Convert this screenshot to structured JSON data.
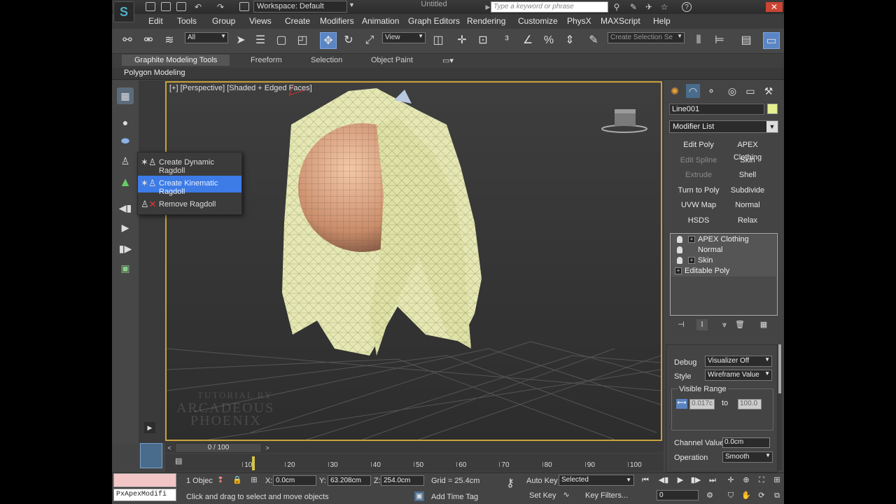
{
  "titlebar": {
    "workspace": "Workspace: Default",
    "doc_title": "Untitled",
    "search_placeholder": "Type a keyword or phrase"
  },
  "menu": [
    "Edit",
    "Tools",
    "Group",
    "Views",
    "Create",
    "Modifiers",
    "Animation",
    "Graph Editors",
    "Rendering",
    "Customize",
    "PhysX",
    "MAXScript",
    "Help"
  ],
  "toolbar": {
    "filter_value": "All",
    "refcoord_value": "View",
    "selection_set_placeholder": "Create Selection Se"
  },
  "ribbon": {
    "tabs": [
      "Graphite Modeling Tools",
      "Freeform",
      "Selection",
      "Object Paint"
    ],
    "sublabel": "Polygon Modeling"
  },
  "flyout": {
    "items": [
      "Create Dynamic Ragdoll",
      "Create Kinematic Ragdoll",
      "Remove Ragdoll"
    ]
  },
  "viewport": {
    "label": "[+] [Perspective] [Shaded + Edged Faces]",
    "watermark_line1": "TUTORIAL BY",
    "watermark_line2": "ARCADEOUS",
    "watermark_line3": "PHOENIX"
  },
  "command_panel": {
    "object_name": "Line001",
    "object_color": "#e6f08f",
    "modifier_list": "Modifier List",
    "modifier_buttons": [
      {
        "label": "Edit Poly",
        "dim": false
      },
      {
        "label": "APEX Clothing",
        "dim": false
      },
      {
        "label": "Edit Spline",
        "dim": true
      },
      {
        "label": "Skin",
        "dim": false
      },
      {
        "label": "Extrude",
        "dim": true
      },
      {
        "label": "Shell",
        "dim": false
      },
      {
        "label": "Turn to Poly",
        "dim": false
      },
      {
        "label": "Subdivide",
        "dim": false
      },
      {
        "label": "UVW Map",
        "dim": false
      },
      {
        "label": "Normal",
        "dim": false
      },
      {
        "label": "HSDS",
        "dim": false
      },
      {
        "label": "Relax",
        "dim": false
      }
    ],
    "stack": [
      "APEX Clothing",
      "Normal",
      "Skin",
      "Editable Poly"
    ],
    "debug_label": "Debug",
    "debug_value": "Visualizer Off",
    "style_label": "Style",
    "style_value": "Wireframe Value",
    "visible_range_label": "Visible Range",
    "range_from": "0.017c",
    "range_to_label": "to",
    "range_to": "100.0",
    "channel_value_label": "Channel Value",
    "channel_value": "0.0cm",
    "operation_label": "Operation",
    "operation_value": "Smooth"
  },
  "timeline": {
    "frame_display": "0 / 100",
    "ticks": [
      10,
      20,
      30,
      40,
      50,
      60,
      70,
      80,
      90,
      100
    ]
  },
  "status": {
    "maxscript_text": "PxApexModifi",
    "selection_count": "1 Objec",
    "x_label": "X:",
    "x_value": "0.0cm",
    "y_label": "Y:",
    "y_value": "63.208cm",
    "z_label": "Z:",
    "z_value": "254.0cm",
    "grid": "Grid = 25.4cm",
    "prompt": "Click and drag to select and move objects",
    "add_time_tag": "Add Time Tag",
    "auto_key": "Auto Key",
    "set_key": "Set Key",
    "key_mode_value": "Selected",
    "key_filters": "Key Filters...",
    "current_frame": "0"
  }
}
